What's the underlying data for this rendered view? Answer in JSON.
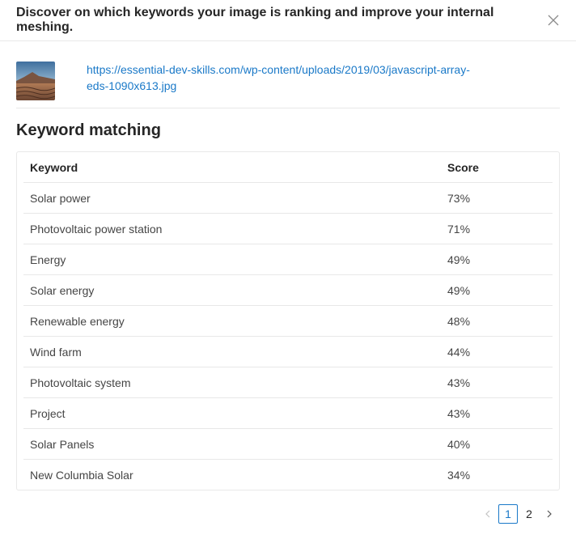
{
  "modal": {
    "title": "Discover on which keywords your image is ranking and improve your internal meshing."
  },
  "image": {
    "url": "https://essential-dev-skills.com/wp-content/uploads/2019/03/javascript-array-eds-1090x613.jpg"
  },
  "section": {
    "title": "Keyword matching"
  },
  "table": {
    "headers": {
      "keyword": "Keyword",
      "score": "Score"
    },
    "rows": [
      {
        "keyword": "Solar power",
        "score": "73%"
      },
      {
        "keyword": "Photovoltaic power station",
        "score": "71%"
      },
      {
        "keyword": "Energy",
        "score": "49%"
      },
      {
        "keyword": "Solar energy",
        "score": "49%"
      },
      {
        "keyword": "Renewable energy",
        "score": "48%"
      },
      {
        "keyword": "Wind farm",
        "score": "44%"
      },
      {
        "keyword": "Photovoltaic system",
        "score": "43%"
      },
      {
        "keyword": "Project",
        "score": "43%"
      },
      {
        "keyword": "Solar Panels",
        "score": "40%"
      },
      {
        "keyword": "New Columbia Solar",
        "score": "34%"
      }
    ]
  },
  "pagination": {
    "pages": [
      "1",
      "2"
    ],
    "current": "1"
  },
  "colors": {
    "accent": "#1a79c8",
    "border": "#e8e8e8"
  },
  "icons": {
    "close": "close-icon",
    "prev": "chevron-left-icon",
    "next": "chevron-right-icon"
  }
}
